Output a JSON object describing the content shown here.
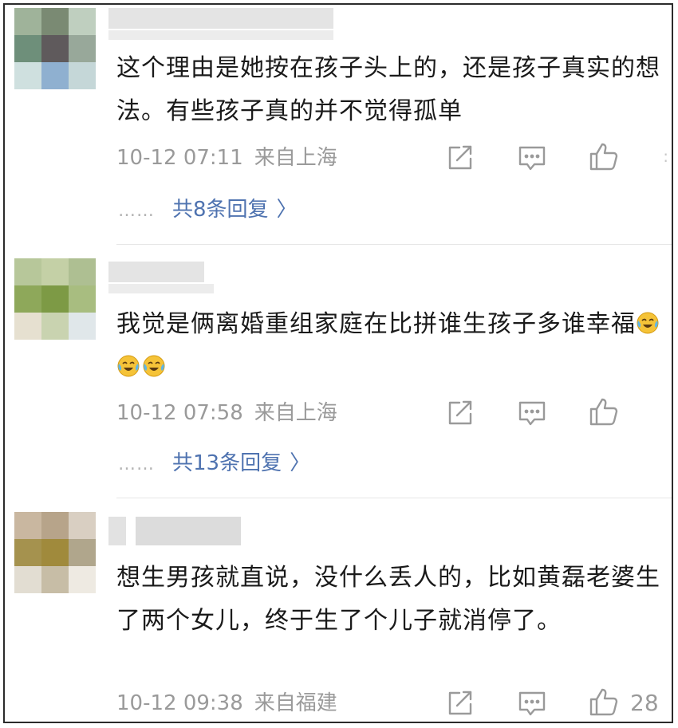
{
  "comments": [
    {
      "text": "这个理由是她按在孩子头上的，还是孩子真实的想法。有些孩子真的并不觉得孤单",
      "time": "10-12 07:11",
      "location": "来自上海",
      "replies": "共8条回复",
      "likes": "",
      "avatar_colors": [
        "#9fb39a",
        "#7a8a73",
        "#bfcfbf",
        "#6e8f7a",
        "#5f5a5c",
        "#98a89a",
        "#cfe0df",
        "#8fb0d0",
        "#c5d7d8"
      ]
    },
    {
      "text": "我觉是俩离婚重组家庭在比拼谁生孩子多谁幸福",
      "time": "10-12 07:58",
      "location": "来自上海",
      "replies": "共13条回复",
      "likes": "",
      "avatar_colors": [
        "#b7c79a",
        "#c4d0a6",
        "#aebf92",
        "#8ea85a",
        "#7d9a45",
        "#a8bd80",
        "#e6e0d0",
        "#c9d3b0",
        "#e0e7ea"
      ]
    },
    {
      "text": "想生男孩就直说，没什么丢人的，比如黄磊老婆生了两个女儿，终于生了个儿子就消停了。",
      "time": "10-12 09:38",
      "location": "来自福建",
      "replies": "",
      "likes": "28",
      "avatar_colors": [
        "#c9b7a0",
        "#b7a48a",
        "#d9cfc2",
        "#a5924e",
        "#a08a3c",
        "#b0a68c",
        "#e2ddd2",
        "#c7bda6",
        "#eeeae2"
      ]
    }
  ],
  "colors": {
    "text": "#1a1a1a",
    "meta": "#9a9a9a",
    "reply_link": "#4f73b0",
    "divider": "#e6e6e6"
  },
  "icons": [
    "share-icon",
    "comment-icon",
    "like-icon",
    "chevron-right-icon",
    "crying-laughing-emoji"
  ]
}
